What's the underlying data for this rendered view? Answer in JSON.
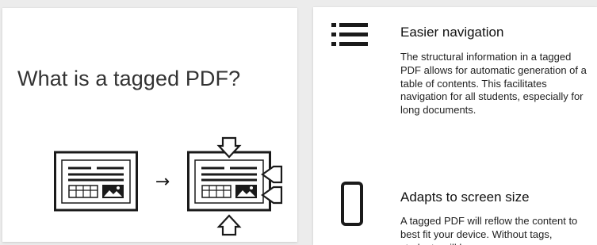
{
  "intro": {
    "title": "What is a tagged PDF?"
  },
  "diagram": {
    "arrow": "→",
    "icons": [
      "untagged-document-icon",
      "tagged-document-icon"
    ]
  },
  "features": [
    {
      "icon": "list-icon",
      "title": "Easier navigation",
      "text": "The structural information in a tagged PDF allows for automatic generation of a table of contents. This facilitates navigation for all students, especially for long documents."
    },
    {
      "icon": "phone-icon",
      "title": "Adapts to screen size",
      "text": "A tagged PDF will reflow the content to best fit your device. Without tags, students will be"
    }
  ],
  "colors": {
    "icon": "#1a1a1a",
    "background": "#ececec",
    "card": "#ffffff"
  }
}
